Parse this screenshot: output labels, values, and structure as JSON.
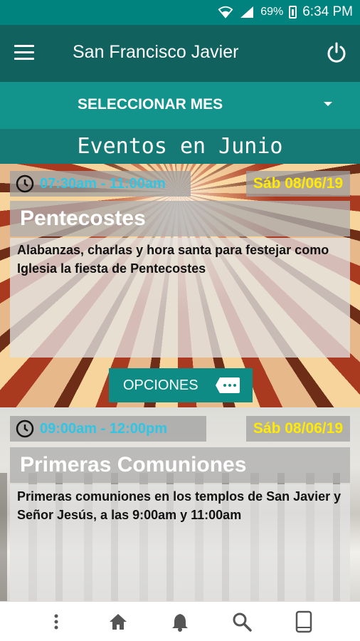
{
  "status_bar": {
    "battery": "69%",
    "time": "6:34 PM"
  },
  "app_bar": {
    "title": "San Francisco Javier",
    "menu_icon": "hamburger-menu-icon",
    "power_icon": "power-icon"
  },
  "month_selector": {
    "label": "SELECCIONAR MES",
    "icon": "dropdown-caret-icon"
  },
  "heading": "Eventos en Junio",
  "events": [
    {
      "time": "07:30am - 11:00am",
      "date": "Sáb 08/06/19",
      "title": "Pentecostes",
      "description": "Alabanzas, charlas y hora santa para festejar como Iglesia la fiesta de Pentecostes",
      "options_label": "OPCIONES"
    },
    {
      "time": "09:00am - 12:00pm",
      "date": "Sáb 08/06/19",
      "title": "Primeras Comuniones",
      "description": "Primeras comuniones en los templos de San Javier y Señor Jesús, a las 9:00am y 11:00am"
    }
  ],
  "bottom_nav": [
    "more-vertical-icon",
    "home-icon",
    "bell-icon",
    "search-icon",
    "tablet-icon"
  ],
  "colors": {
    "accent": "#12938c",
    "appbar": "#11625f",
    "time_text": "#2fc6e6",
    "date_text": "#ffea00"
  }
}
